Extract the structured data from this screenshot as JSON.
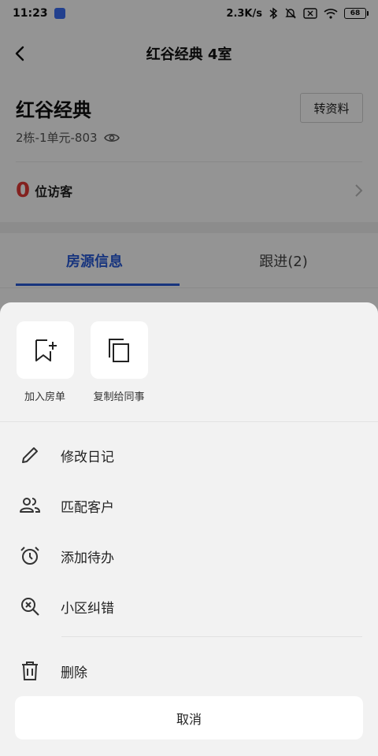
{
  "status_bar": {
    "time": "11:23",
    "network_speed": "2.3K/s",
    "battery": "68",
    "icons": [
      "bluetooth-icon",
      "mute-icon",
      "sim-off-icon",
      "wifi-icon",
      "battery-icon"
    ]
  },
  "header": {
    "title": "红谷经典 4室",
    "back_icon": "chevron-left-icon"
  },
  "house": {
    "name": "红谷经典",
    "address": "2栋-1单元-803",
    "transfer_label": "转资料"
  },
  "visitors": {
    "count": "0",
    "label": "位访客"
  },
  "tabs": [
    {
      "label": "房源信息",
      "active": true
    },
    {
      "label": "跟进(2)",
      "active": false
    }
  ],
  "sheet": {
    "quick_actions": [
      {
        "label": "加入房单",
        "icon": "bookmark-add-icon"
      },
      {
        "label": "复制给同事",
        "icon": "copy-icon"
      }
    ],
    "menu": [
      {
        "label": "修改日记",
        "icon": "pencil-icon"
      },
      {
        "label": "匹配客户",
        "icon": "users-icon"
      },
      {
        "label": "添加待办",
        "icon": "alarm-clock-icon"
      },
      {
        "label": "小区纠错",
        "icon": "search-x-icon"
      },
      {
        "label": "删除",
        "icon": "trash-icon"
      }
    ],
    "cancel_label": "取消"
  },
  "colors": {
    "accent": "#2a5cd9",
    "visitor_count": "#e23a36",
    "overlay": "rgba(0,0,0,0.42)",
    "sheet_bg": "#f2f2f2"
  }
}
